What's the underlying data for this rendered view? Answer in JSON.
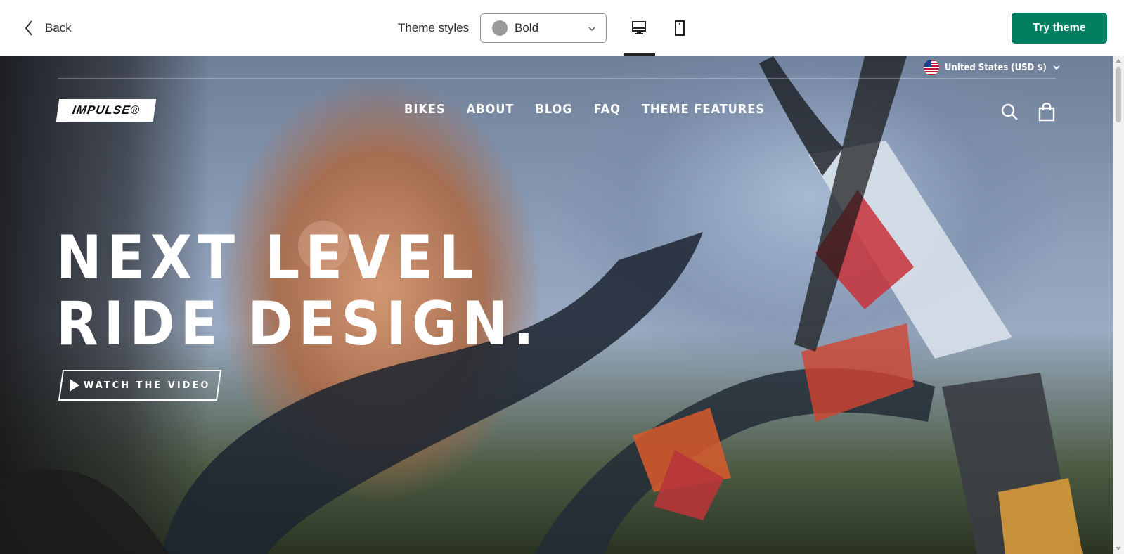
{
  "editor": {
    "back_label": "Back",
    "theme_styles_label": "Theme styles",
    "theme_style_value": "Bold",
    "swatch_color": "#9a9a9a",
    "view_modes": [
      "desktop",
      "mobile"
    ],
    "active_view": "desktop",
    "try_theme_label": "Try theme",
    "accent_color": "#008060"
  },
  "store": {
    "currency_label": "United States (USD $)",
    "logo_text": "IMPULSE®",
    "nav": [
      {
        "label": "BIKES"
      },
      {
        "label": "ABOUT"
      },
      {
        "label": "BLOG"
      },
      {
        "label": "FAQ"
      },
      {
        "label": "THEME FEATURES"
      }
    ],
    "icons": [
      "search-icon",
      "cart-icon"
    ],
    "hero": {
      "title_line1": "NEXT LEVEL",
      "title_line2": "RIDE DESIGN.",
      "button_label": "WATCH THE VIDEO"
    }
  }
}
